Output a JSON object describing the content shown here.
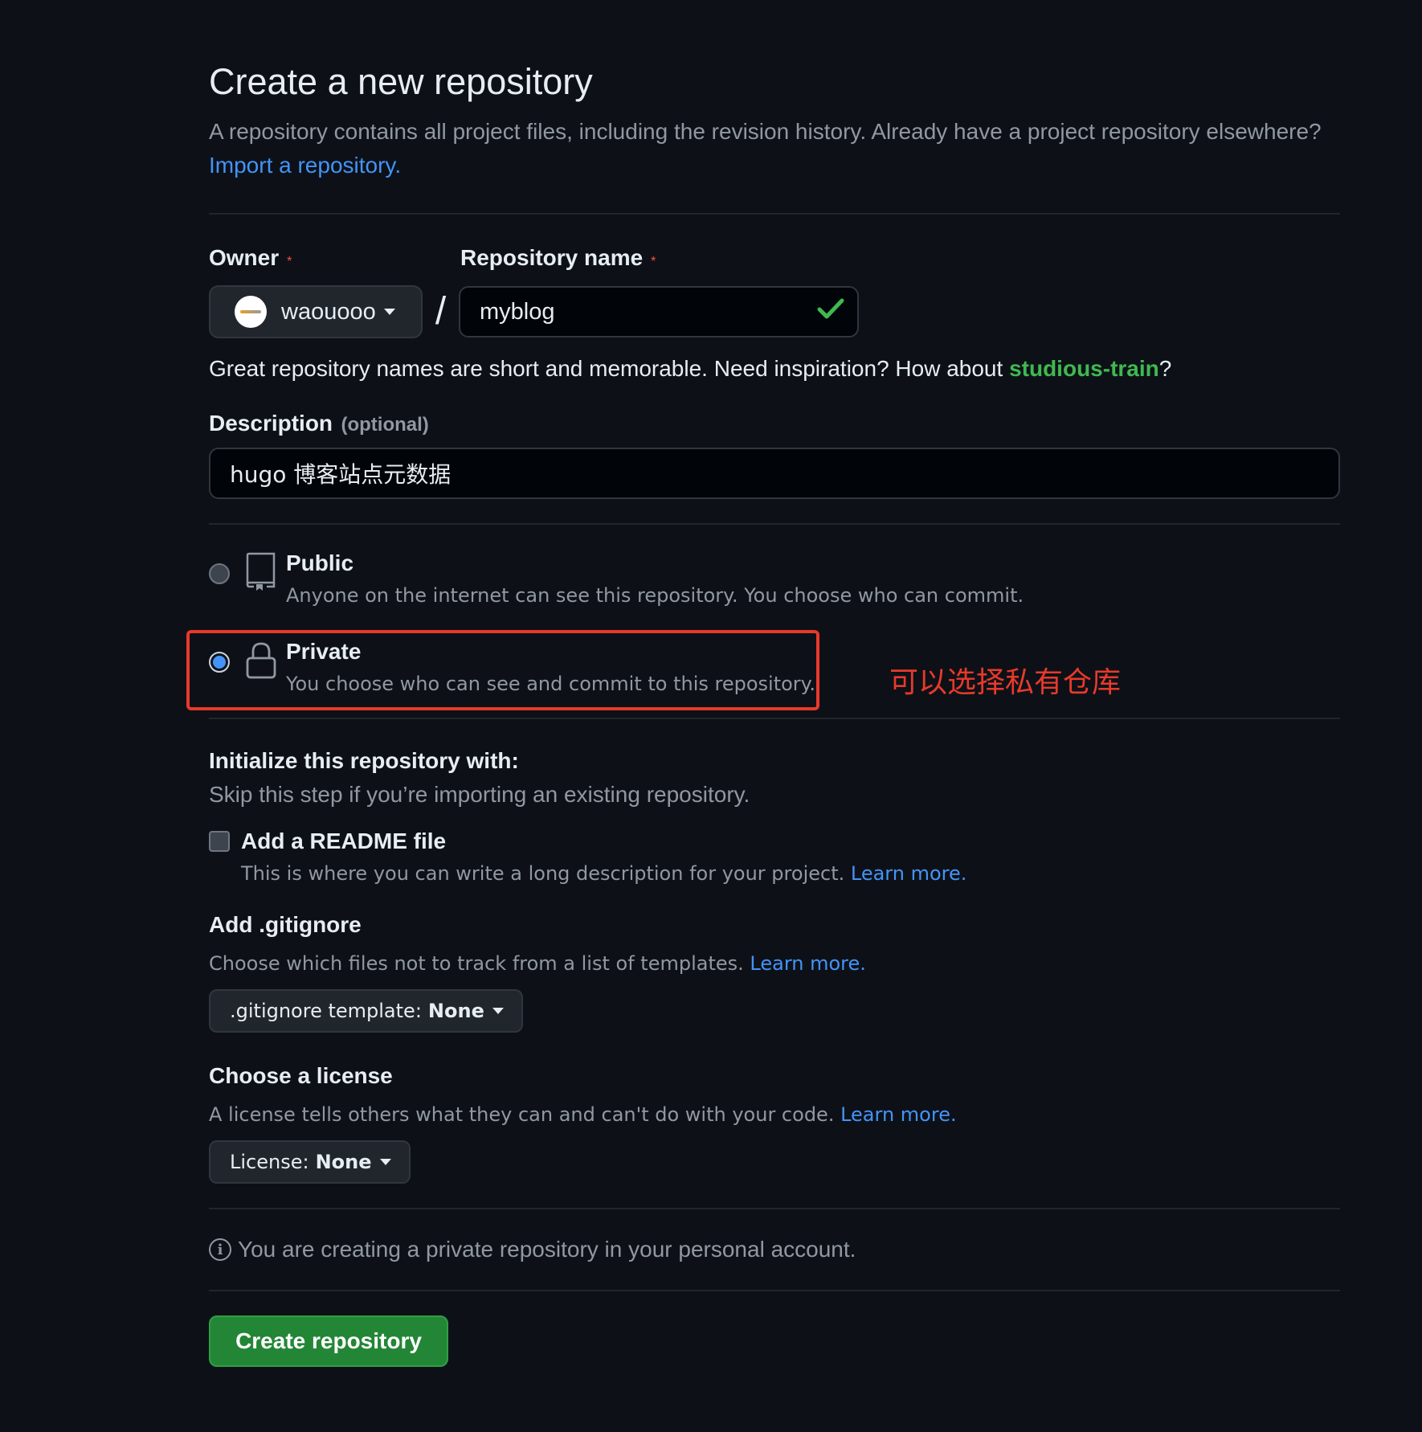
{
  "header": {
    "title": "Create a new repository",
    "subtitle_text": "A repository contains all project files, including the revision history. Already have a project repository elsewhere?",
    "import_link": "Import a repository."
  },
  "form": {
    "owner_label": "Owner",
    "repo_label": "Repository name",
    "required_mark": "*",
    "owner_value": "waouooo",
    "slash": "/",
    "repo_value": "myblog",
    "hint_text": "Great repository names are short and memorable. Need inspiration? How about ",
    "hint_suggestion": "studious-train",
    "hint_end": "?",
    "description_label": "Description",
    "description_optional": "(optional)",
    "description_value": "hugo 博客站点元数据"
  },
  "visibility": {
    "selected": "private",
    "public_title": "Public",
    "public_desc": "Anyone on the internet can see this repository. You choose who can commit.",
    "private_title": "Private",
    "private_desc": "You choose who can see and commit to this repository.",
    "annotation": "可以选择私有仓库",
    "annotation_color": "#e8392b"
  },
  "init": {
    "title": "Initialize this repository with:",
    "subtitle": "Skip this step if you’re importing an existing repository.",
    "readme_label": "Add a README file",
    "readme_checked": false,
    "readme_desc": "This is where you can write a long description for your project.",
    "learn_more": "Learn more."
  },
  "gitignore": {
    "title": "Add .gitignore",
    "desc": "Choose which files not to track from a list of templates.",
    "learn_more": "Learn more.",
    "select_label": ".gitignore template:",
    "select_value": "None"
  },
  "license": {
    "title": "Choose a license",
    "desc": "A license tells others what they can and can't do with your code.",
    "learn_more": "Learn more.",
    "select_label": "License:",
    "select_value": "None"
  },
  "footer": {
    "info_icon": "i",
    "info_text": "You are creating a private repository in your personal account.",
    "create_button": "Create repository"
  },
  "colors": {
    "background": "#0d1117",
    "link": "#4493f8",
    "success": "#3fb950",
    "primary_button": "#238636",
    "danger": "#f85149"
  }
}
